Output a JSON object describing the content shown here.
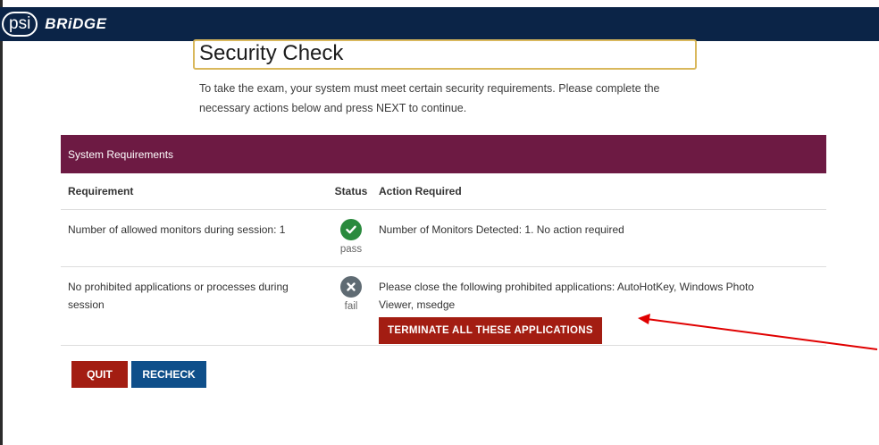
{
  "header": {
    "logo_text": "psi",
    "brand": "BRiDGE"
  },
  "page": {
    "title": "Security Check",
    "intro_line1": "To take the exam, your system must meet certain security requirements. Please complete the",
    "intro_line2": "necessary actions below and press NEXT to continue."
  },
  "requirements": {
    "panel_title": "System Requirements",
    "columns": {
      "requirement": "Requirement",
      "status": "Status",
      "action": "Action Required"
    },
    "rows": [
      {
        "requirement": "Number of allowed monitors during session: 1",
        "status": "pass",
        "status_icon": "check-circle-icon",
        "action": "Number of Monitors Detected: 1. No action required"
      },
      {
        "requirement_line1": "No prohibited applications or processes during",
        "requirement_line2": "session",
        "status": "fail",
        "status_icon": "x-circle-icon",
        "action_line1": "Please close the following prohibited applications: AutoHotKey, Windows Photo",
        "action_line2": "Viewer, msedge",
        "action_button": "TERMINATE ALL THESE APPLICATIONS"
      }
    ]
  },
  "footer": {
    "quit_label": "QUIT",
    "recheck_label": "RECHECK"
  },
  "colors": {
    "header_bg": "#0b2447",
    "panel_header": "#6d1a43",
    "danger": "#a31d12",
    "primary": "#0f4f8a",
    "pass": "#2a8a3d",
    "fail": "#5f6b73",
    "annotation_arrow": "#e00000"
  }
}
